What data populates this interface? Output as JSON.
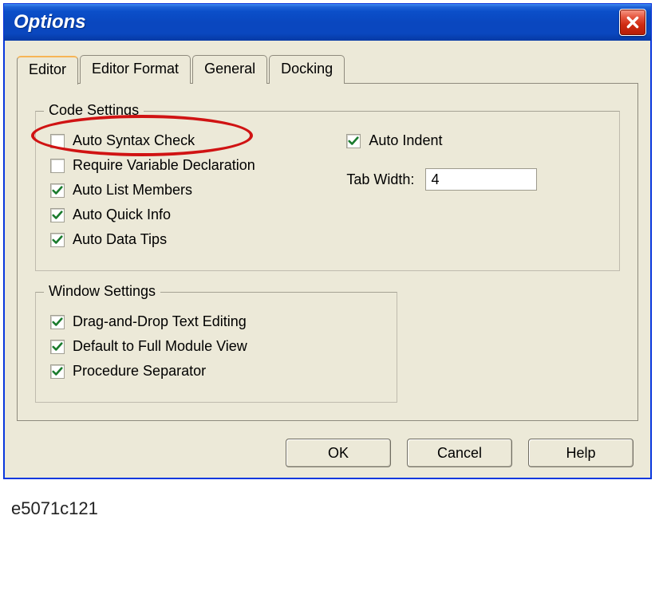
{
  "window": {
    "title": "Options"
  },
  "tabs": {
    "editor": "Editor",
    "editor_format": "Editor Format",
    "general": "General",
    "docking": "Docking",
    "active": "editor"
  },
  "code_settings": {
    "legend": "Code Settings",
    "auto_syntax_check": {
      "label": "Auto Syntax Check",
      "checked": false
    },
    "require_var_decl": {
      "label": "Require Variable Declaration",
      "checked": false
    },
    "auto_list_members": {
      "label": "Auto List Members",
      "checked": true
    },
    "auto_quick_info": {
      "label": "Auto Quick Info",
      "checked": true
    },
    "auto_data_tips": {
      "label": "Auto Data Tips",
      "checked": true
    },
    "auto_indent": {
      "label": "Auto Indent",
      "checked": true
    },
    "tab_width_label": "Tab Width:",
    "tab_width_value": "4"
  },
  "window_settings": {
    "legend": "Window Settings",
    "drag_drop": {
      "label": "Drag-and-Drop Text Editing",
      "checked": true
    },
    "full_module_view": {
      "label": "Default to Full Module View",
      "checked": true
    },
    "procedure_separator": {
      "label": "Procedure Separator",
      "checked": true
    }
  },
  "buttons": {
    "ok": "OK",
    "cancel": "Cancel",
    "help": "Help"
  },
  "footer_label": "e5071c121"
}
